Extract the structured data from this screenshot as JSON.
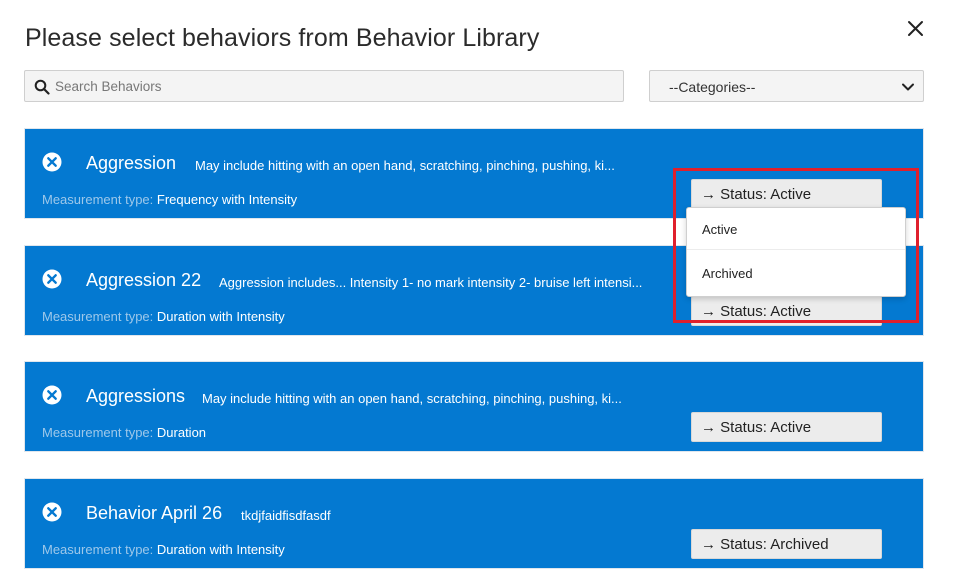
{
  "dialog": {
    "title": "Please select behaviors from Behavior Library",
    "close_icon": "close-icon"
  },
  "search": {
    "placeholder": "Search Behaviors",
    "value": ""
  },
  "categories": {
    "selected": "--Categories--"
  },
  "measurement_label": "Measurement type: ",
  "behaviors": [
    {
      "name": "Aggression",
      "description": "May include hitting with an open hand, scratching, pinching, pushing, ki...",
      "measurement": "Frequency with Intensity",
      "status": "→ Status: Active"
    },
    {
      "name": "Aggression 22",
      "description": "Aggression includes... Intensity 1- no mark intensity 2- bruise left intensi...",
      "measurement": "Duration with Intensity",
      "status": "→ Status: Active"
    },
    {
      "name": "Aggressions",
      "description": "May include hitting with an open hand, scratching, pinching, pushing, ki...",
      "measurement": "Duration",
      "status": "→ Status: Active"
    },
    {
      "name": "Behavior April 26",
      "description": "tkdjfaidfisdfasdf",
      "measurement": "Duration with Intensity",
      "status": "→ Status: Archived"
    }
  ],
  "status_dropdown": {
    "options": [
      "Active",
      "Archived"
    ]
  },
  "colors": {
    "card_bg": "#0479d1",
    "highlight": "#e0202c"
  }
}
